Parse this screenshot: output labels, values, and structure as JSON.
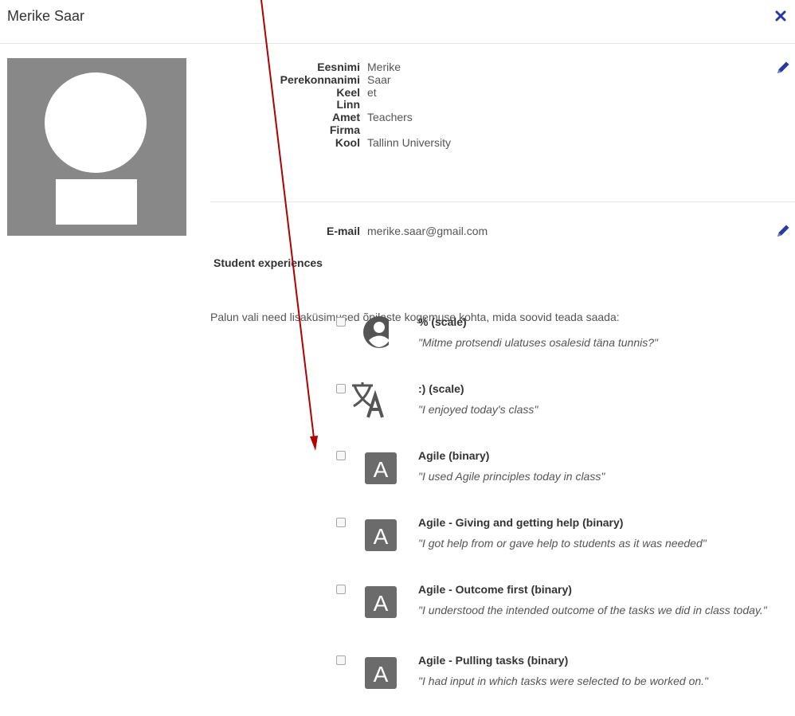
{
  "header": {
    "title": "Merike Saar"
  },
  "profile": {
    "fields": [
      {
        "label": "Eesnimi",
        "value": "Merike"
      },
      {
        "label": "Perekonnanimi",
        "value": "Saar"
      },
      {
        "label": "Keel",
        "value": "et"
      },
      {
        "label": "Linn",
        "value": ""
      },
      {
        "label": "Amet",
        "value": "Teachers"
      },
      {
        "label": "Firma",
        "value": ""
      },
      {
        "label": "Kool",
        "value": "Tallinn University"
      }
    ],
    "email": {
      "label": "E-mail",
      "value": "merike.saar@gmail.com"
    }
  },
  "experiences": {
    "title": "Student experiences",
    "instructions": "Palun vali need lisaküsimused õpilaste kogemuse kohta, mida soovid teada saada:",
    "items": [
      {
        "icon": "account-circle-icon",
        "name": "% (scale)",
        "desc": "\"Mitme protsendi ulatuses osalesid täna tunnis?\""
      },
      {
        "icon": "translate-icon",
        "name": ":) (scale)",
        "desc": "\"I enjoyed today's class\""
      },
      {
        "icon": "letter-a-icon",
        "name": "Agile (binary)",
        "desc": "\"I used Agile principles today in class\""
      },
      {
        "icon": "letter-a-icon",
        "name": "Agile - Giving and getting help (binary)",
        "desc": "\"I got help from or gave help to students as it was needed\""
      },
      {
        "icon": "letter-a-icon",
        "name": "Agile - Outcome first (binary)",
        "desc": "\"I understood the intended outcome of the tasks we did in class today.\""
      },
      {
        "icon": "letter-a-icon",
        "name": "Agile - Pulling tasks (binary)",
        "desc": "\"I had input in which tasks were selected to be worked on.\"",
        "letter": "A"
      }
    ],
    "letter": "A"
  },
  "colors": {
    "accent": "#2a3a9c",
    "arrow": "#b00000",
    "avatar_bg": "#888888",
    "icon_bg": "#6b6b6b"
  }
}
